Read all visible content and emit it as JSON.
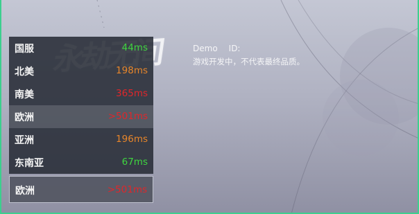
{
  "logo_text": "永劫无间",
  "demo": {
    "label": "Demo",
    "id_label": "ID:",
    "note": "游戏开发中，不代表最终品质。"
  },
  "servers": [
    {
      "name": "国服",
      "ping": "44ms",
      "color": "#3fd63f"
    },
    {
      "name": "北美",
      "ping": "198ms",
      "color": "#e8862a"
    },
    {
      "name": "南美",
      "ping": "365ms",
      "color": "#e0262a"
    },
    {
      "name": "欧洲",
      "ping": ">501ms",
      "color": "#e0262a"
    },
    {
      "name": "亚洲",
      "ping": "196ms",
      "color": "#e8862a"
    },
    {
      "name": "东南亚",
      "ping": "67ms",
      "color": "#3fd63f"
    }
  ],
  "selected_server": {
    "name": "欧洲",
    "ping": ">501ms",
    "color": "#e0262a"
  },
  "colors": {
    "accent_edge": "#3ccf8e"
  }
}
